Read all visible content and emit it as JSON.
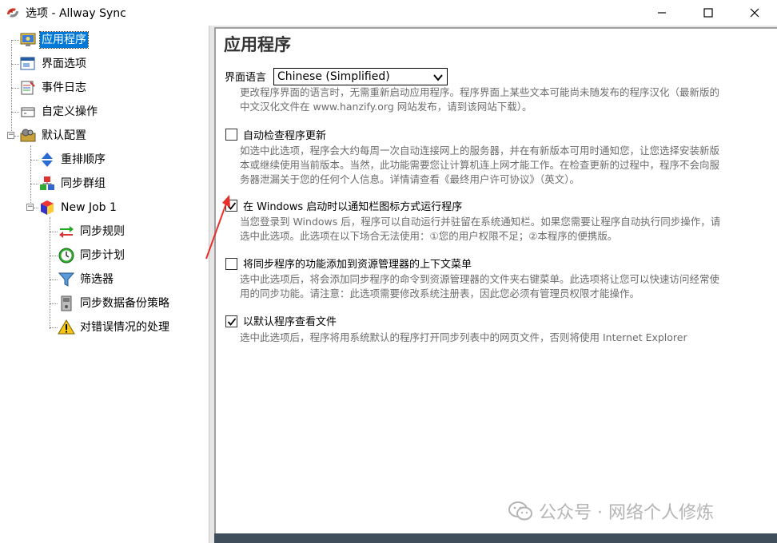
{
  "window": {
    "title": "选项 - Allway Sync",
    "controls": [
      "minimize-icon",
      "maximize-icon",
      "close-icon"
    ]
  },
  "tree": {
    "items": [
      {
        "label": "应用程序",
        "icon": "app-monitor-icon",
        "selected": true
      },
      {
        "label": "界面选项",
        "icon": "window-icon"
      },
      {
        "label": "事件日志",
        "icon": "log-icon"
      },
      {
        "label": "自定义操作",
        "icon": "custom-action-icon"
      },
      {
        "label": "默认配置",
        "icon": "default-config-icon"
      },
      {
        "label": "重排顺序",
        "icon": "reorder-icon"
      },
      {
        "label": "同步群组",
        "icon": "sync-group-icon"
      },
      {
        "label": "New Job 1",
        "icon": "job-cube-icon"
      },
      {
        "label": "同步规则",
        "icon": "sync-rules-icon"
      },
      {
        "label": "同步计划",
        "icon": "schedule-clock-icon"
      },
      {
        "label": "筛选器",
        "icon": "filter-icon"
      },
      {
        "label": "同步数据备份策略",
        "icon": "backup-icon"
      },
      {
        "label": "对错误情况的处理",
        "icon": "warning-icon"
      }
    ]
  },
  "main": {
    "title": "应用程序",
    "language": {
      "label": "界面语言",
      "selected": "Chinese (Simplified)",
      "desc_line1": "更改程序界面的语言时，无需重新启动应用程序。程序界面上某些文本可能尚未随发布的程序汉化（最新版的",
      "desc_line2": "中文汉化文件在 www.hanzify.org 网站发布，请到该网站下载）。"
    },
    "options": [
      {
        "label": "自动检查程序更新",
        "checked": false,
        "desc": [
          "如选中此选项，程序会大约每周一次自动连接网上的服务器，并在有新版本可用时通知您，让您选择安装新版",
          "本或继续使用当前版本。当然，此功能需要您让计算机连上网才能工作。在检查更新的过程中，程序不会向服",
          "务器泄漏关于您的任何个人信息。详情请查看《最终用户许可协议》（英文）。"
        ]
      },
      {
        "label": "在 Windows 启动时以通知栏图标方式运行程序",
        "checked": true,
        "desc": [
          "当您登录到 Windows 后，程序可以自动运行并驻留在系统通知栏。如果您需要让程序自动执行同步操作，请",
          "选中此选项。此选项在以下场合无法使用：①您的用户权限不足；②本程序的便携版。"
        ]
      },
      {
        "label": "将同步程序的功能添加到资源管理器的上下文菜单",
        "checked": false,
        "desc": [
          "选中此选项后，将会添加同步程序的命令到资源管理器的文件夹右键菜单。此选项将让您可以快速访问经常使",
          "用的同步功能。请注意：此选项需要修改系统注册表，因此您必须有管理员权限才能操作。"
        ]
      },
      {
        "label": "以默认程序查看文件",
        "checked": true,
        "desc": [
          "选中此选项后，程序将用系统默认的程序打开同步列表中的网页文件，否则将使用 Internet Explorer"
        ]
      }
    ]
  },
  "watermark": {
    "text": "公众号 · 网络个人修炼"
  },
  "colors": {
    "selection": "#0078d7",
    "annotation_arrow": "#e8302a",
    "description_text": "#6d6d6d"
  }
}
